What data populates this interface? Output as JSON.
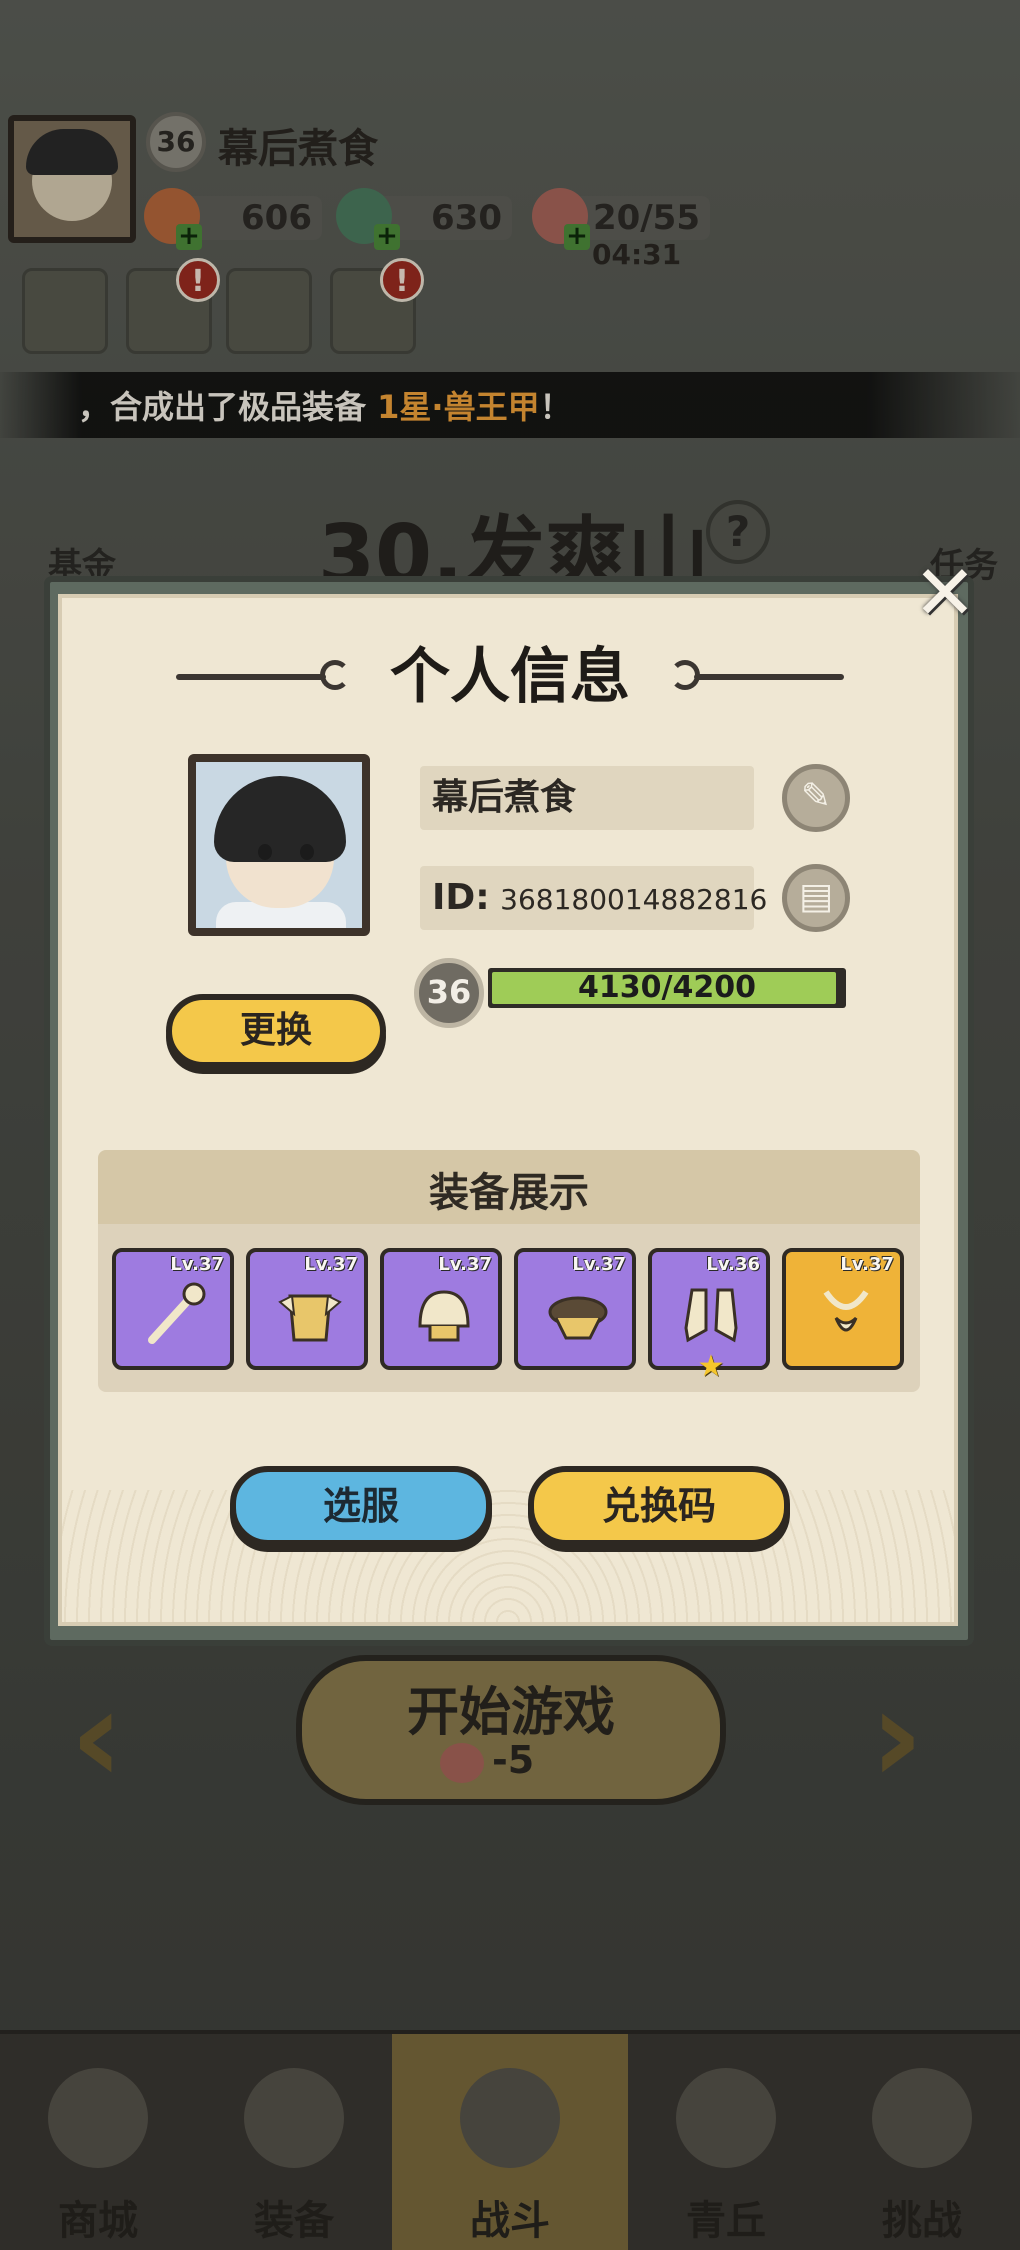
{
  "player": {
    "name": "幕后煮食",
    "level": "36"
  },
  "resources": {
    "gold": "606",
    "jade": "630",
    "stamina": "20/55",
    "stamina_timer": "04:31"
  },
  "marquee": {
    "prefix": "，合成出了极品装备 ",
    "highlight": "1星·兽王甲",
    "suffix": "！"
  },
  "stage": {
    "title": "30.发爽山",
    "help": "?"
  },
  "side_labels": {
    "fund": "基金",
    "task": "任务"
  },
  "modal": {
    "title": "个人信息",
    "close": "✕",
    "name": "幕后煮食",
    "id_label": "ID:",
    "id_value": "368180014882816",
    "level": "36",
    "exp_text": "4130/4200",
    "exp_fraction": 0.983,
    "change_btn": "更换",
    "equip_title": "装备展示",
    "equipment": [
      {
        "level": "Lv.37",
        "rarity": "purple",
        "icon": "staff-icon"
      },
      {
        "level": "Lv.37",
        "rarity": "purple",
        "icon": "armor-icon"
      },
      {
        "level": "Lv.37",
        "rarity": "purple",
        "icon": "helmet-icon"
      },
      {
        "level": "Lv.37",
        "rarity": "purple",
        "icon": "bracer-icon"
      },
      {
        "level": "Lv.36",
        "rarity": "purple",
        "icon": "boots-icon",
        "starred": true
      },
      {
        "level": "Lv.37",
        "rarity": "gold",
        "icon": "necklace-icon"
      }
    ],
    "server_btn": "选服",
    "redeem_btn": "兑换码"
  },
  "start": {
    "label": "开始游戏",
    "cost": "-5"
  },
  "nav": {
    "items": [
      "商城",
      "装备",
      "战斗",
      "青丘",
      "挑战"
    ],
    "active": "战斗"
  },
  "colors": {
    "accent_yellow": "#f4c84a",
    "accent_blue": "#5db6e0",
    "rarity_purple": "#9e7be0",
    "rarity_gold": "#efb338",
    "exp_green": "#9fcc57",
    "highlight_orange": "#f0a23a"
  }
}
